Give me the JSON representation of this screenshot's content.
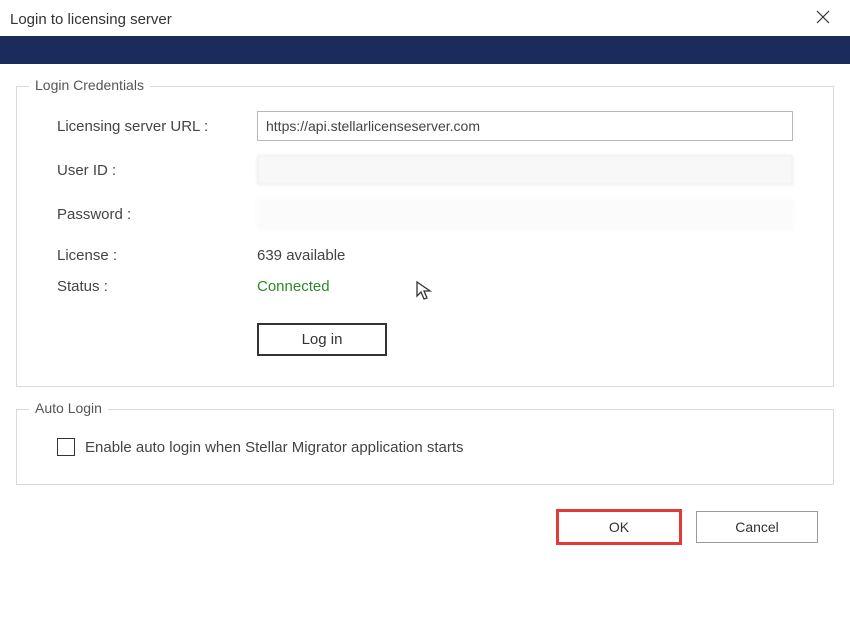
{
  "window": {
    "title": "Login to licensing server"
  },
  "credentials": {
    "legend": "Login Credentials",
    "url_label": "Licensing server URL :",
    "url_value": "https://api.stellarlicenseserver.com",
    "user_label": "User ID :",
    "password_label": "Password :",
    "license_label": "License :",
    "license_value": "639 available",
    "status_label": "Status :",
    "status_value": "Connected",
    "login_button": "Log in"
  },
  "auto": {
    "legend": "Auto Login",
    "checkbox_label": "Enable auto login when Stellar Migrator application starts",
    "checked": false
  },
  "footer": {
    "ok": "OK",
    "cancel": "Cancel"
  },
  "colors": {
    "header_bar": "#1a2b5c",
    "status_connected": "#2b8a2b",
    "ok_highlight": "#e03a3a"
  }
}
